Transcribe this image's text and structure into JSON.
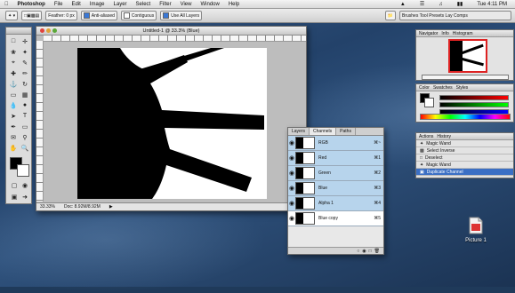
{
  "menubar": {
    "apple": "",
    "items": [
      "Photoshop",
      "File",
      "Edit",
      "Image",
      "Layer",
      "Select",
      "Filter",
      "View",
      "Window",
      "Help"
    ],
    "clock": "Tue 4:11 PM"
  },
  "options": {
    "feather_label": "Feather:",
    "feather_value": "0 px",
    "antialias_label": "Anti-aliased",
    "contiguous_label": "Contiguous",
    "sample_label": "Use All Layers",
    "palette_label": "Brushes  Tool Presets  Lay  Comps"
  },
  "document": {
    "title": "Untitled-1 @ 33.3% (Blue)",
    "zoom": "33.33%",
    "doc_size": "Doc: 8.92M/8.92M"
  },
  "layers_panel": {
    "tabs": [
      "Layers",
      "Channels",
      "Paths"
    ],
    "active_tab": "Channels",
    "channels": [
      {
        "name": "RGB",
        "key": "⌘~",
        "selected": false
      },
      {
        "name": "Red",
        "key": "⌘1",
        "selected": false
      },
      {
        "name": "Green",
        "key": "⌘2",
        "selected": false
      },
      {
        "name": "Blue",
        "key": "⌘3",
        "selected": false
      },
      {
        "name": "Alpha 1",
        "key": "⌘4",
        "selected": false
      },
      {
        "name": "Blue copy",
        "key": "⌘5",
        "selected": true
      }
    ]
  },
  "navigator": {
    "tabs": [
      "Navigator",
      "Info",
      "Histogram"
    ]
  },
  "color_panel": {
    "tabs": [
      "Color",
      "Swatches",
      "Styles"
    ]
  },
  "history_panel": {
    "tabs": [
      "Actions",
      "History"
    ],
    "items": [
      "Magic Wand",
      "Select Inverse",
      "Deselect",
      "Magic Wand",
      "Duplicate Channel"
    ]
  },
  "desktop": {
    "file_label": "Picture 1"
  },
  "colors": {
    "selection": "#3b6fc4",
    "channel_bg": "#b7d4ec"
  }
}
